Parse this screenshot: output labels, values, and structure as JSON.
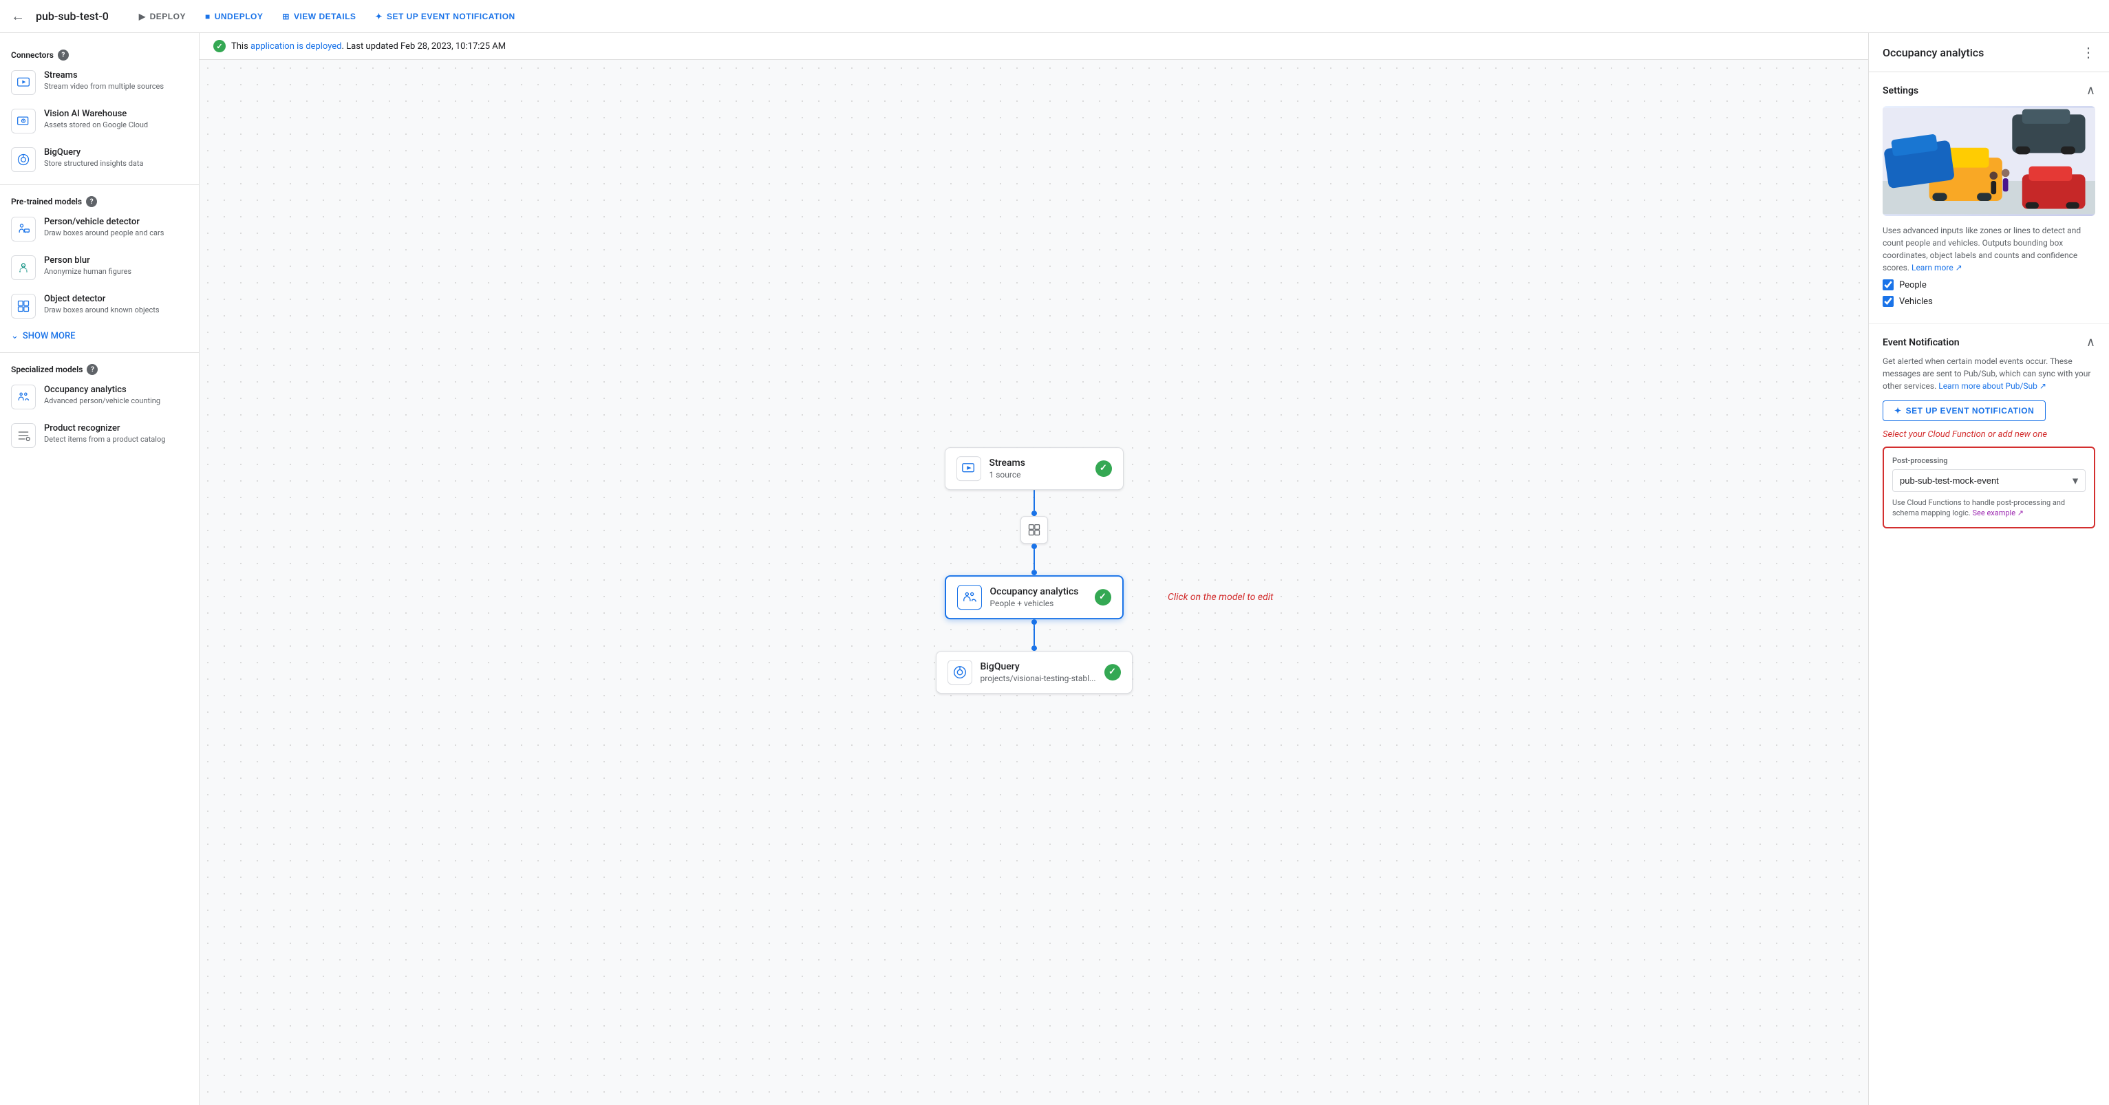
{
  "topbar": {
    "back_icon": "←",
    "title": "pub-sub-test-0",
    "buttons": {
      "deploy": "DEPLOY",
      "undeploy": "UNDEPLOY",
      "view_details": "VIEW DETAILS",
      "setup_event": "SET UP EVENT NOTIFICATION"
    }
  },
  "status": {
    "text_prefix": "This",
    "link_text": "application is deployed",
    "text_suffix": ". Last updated Feb 28, 2023, 10:17:25 AM"
  },
  "sidebar": {
    "connectors_title": "Connectors",
    "pretrained_title": "Pre-trained models",
    "specialized_title": "Specialized models",
    "show_more": "SHOW MORE",
    "connectors": [
      {
        "icon": "🎥",
        "title": "Streams",
        "desc": "Stream video from multiple sources"
      },
      {
        "icon": "▶",
        "title": "Vision AI Warehouse",
        "desc": "Assets stored on Google Cloud"
      },
      {
        "icon": "◎",
        "title": "BigQuery",
        "desc": "Store structured insights data"
      }
    ],
    "pretrained": [
      {
        "icon": "👤",
        "title": "Person/vehicle detector",
        "desc": "Draw boxes around people and cars"
      },
      {
        "icon": "😶",
        "title": "Person blur",
        "desc": "Anonymize human figures"
      },
      {
        "icon": "📦",
        "title": "Object detector",
        "desc": "Draw boxes around known objects"
      }
    ],
    "specialized": [
      {
        "icon": "👥",
        "title": "Occupancy analytics",
        "desc": "Advanced person/vehicle counting"
      },
      {
        "icon": "👕",
        "title": "Product recognizer",
        "desc": "Detect items from a product catalog"
      }
    ]
  },
  "canvas": {
    "click_hint": "Click on the model to edit",
    "nodes": [
      {
        "id": "streams",
        "icon": "🎥",
        "title": "Streams",
        "subtitle": "1 source",
        "checked": true
      },
      {
        "id": "middle",
        "icon": "⊞"
      },
      {
        "id": "occupancy",
        "icon": "👥",
        "title": "Occupancy analytics",
        "subtitle": "People + vehicles",
        "checked": true,
        "selected": true
      },
      {
        "id": "bigquery",
        "icon": "◎",
        "title": "BigQuery",
        "subtitle": "projects/visionai-testing-stabl...",
        "checked": true
      }
    ]
  },
  "right_panel": {
    "title": "Occupancy analytics",
    "settings_title": "Settings",
    "description": "Uses advanced inputs like zones or lines to detect and count people and vehicles. Outputs bounding box coordinates, object labels and counts and confidence scores.",
    "learn_more": "Learn more",
    "checkboxes": [
      {
        "label": "People",
        "checked": true
      },
      {
        "label": "Vehicles",
        "checked": true
      }
    ],
    "event_notification": {
      "title": "Event Notification",
      "description": "Get alerted when certain model events occur. These messages are sent to Pub/Sub, which can sync with your other services.",
      "learn_more_text": "Learn more about Pub/Sub",
      "setup_btn": "SET UP EVENT NOTIFICATION",
      "select_hint": "Select your Cloud Function or add new one",
      "post_processing_label": "Post-processing",
      "select_value": "pub-sub-test-mock-event",
      "cloud_functions_note": "Use Cloud Functions to handle post-processing and schema mapping logic.",
      "see_example": "See example"
    }
  }
}
